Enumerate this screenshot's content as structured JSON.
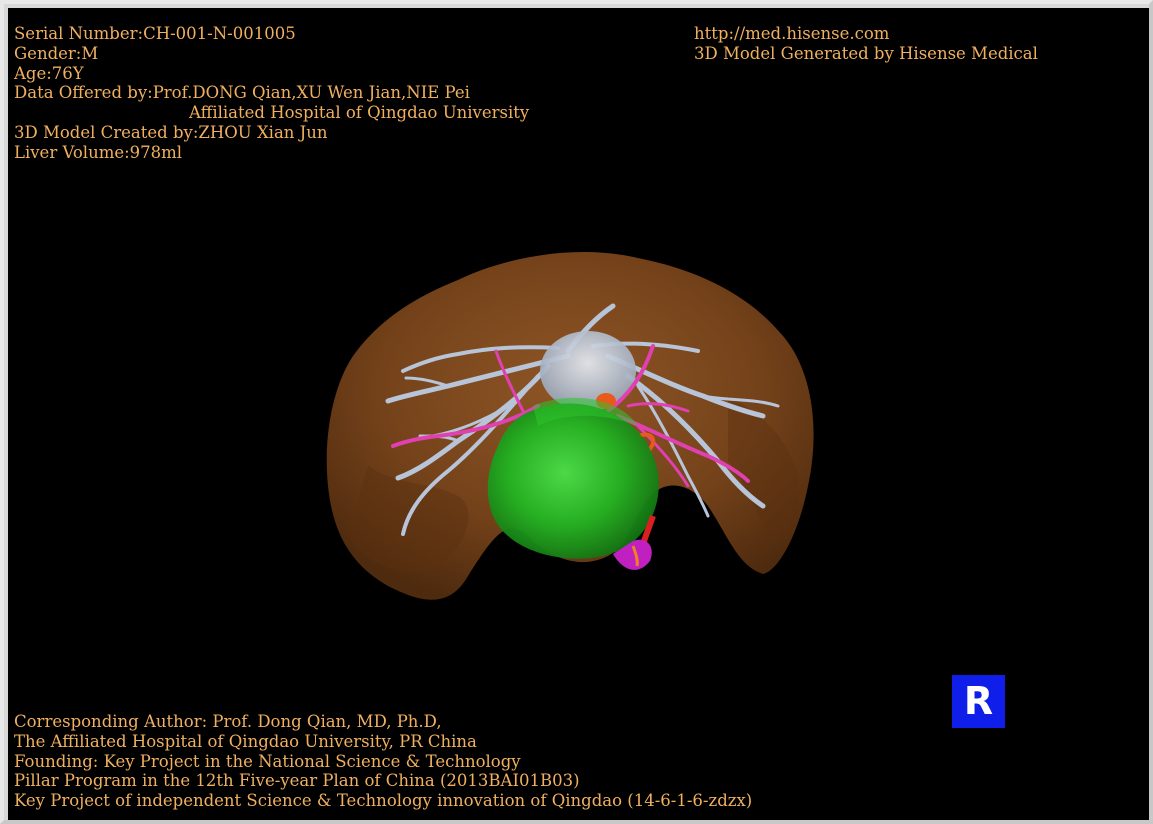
{
  "info": {
    "serial": "Serial Number:CH-001-N-001005",
    "gender": "Gender:M",
    "age": "Age:76Y",
    "data_offered": "Data Offered by:Prof.DONG Qian,XU Wen Jian,NIE Pei",
    "hospital": "Affiliated Hospital of Qingdao University",
    "model_created": "3D Model Created by:ZHOU Xian Jun",
    "liver_volume": "Liver Volume:978ml"
  },
  "header_right": {
    "url": "http://med.hisense.com",
    "generated_by": "3D Model Generated by Hisense Medical"
  },
  "footer": {
    "lines": [
      "Corresponding Author: Prof. Dong Qian, MD, Ph.D,",
      "The Affiliated Hospital of Qingdao University, PR China",
      "Founding: Key Project in the National Science & Technology",
      "Pillar Program in the 12th Five-year Plan of China (2013BAI01B03)",
      "Key Project of independent Science & Technology innovation of Qingdao (14-6-1-6-zdzx)"
    ]
  },
  "orientation_button": {
    "label": "R"
  },
  "colors": {
    "text": "#f0b060",
    "background": "#000000",
    "liver": "#7a4418",
    "tumor": "#22b422",
    "portal_vein": "#b8c4d8",
    "hepatic_artery": "#e040b0",
    "orientation_button": "#0f1ee8"
  }
}
